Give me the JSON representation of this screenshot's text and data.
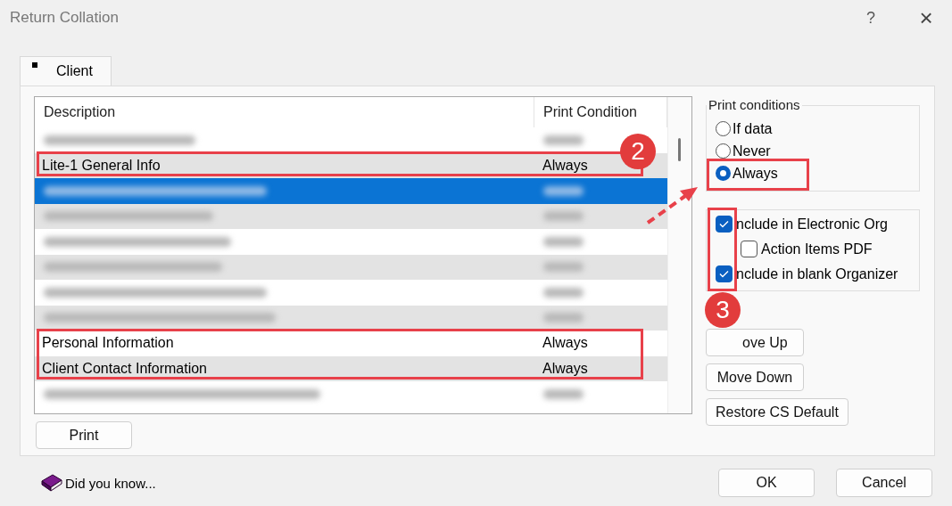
{
  "window": {
    "title": "Return Collation",
    "help": "?",
    "close": "×"
  },
  "tabs": [
    {
      "label": "Client",
      "selected": true
    }
  ],
  "list": {
    "columns": [
      "Description",
      "Print Condition"
    ],
    "rows": [
      {
        "kind": "blurred",
        "selected": false
      },
      {
        "kind": "text",
        "description": "Lite-1 General Info",
        "condition": "Always",
        "selected": false
      },
      {
        "kind": "blurred",
        "selected": true
      },
      {
        "kind": "blurred",
        "selected": false
      },
      {
        "kind": "blurred",
        "selected": false
      },
      {
        "kind": "blurred",
        "selected": false
      },
      {
        "kind": "blurred",
        "selected": false
      },
      {
        "kind": "blurred",
        "selected": false
      },
      {
        "kind": "text",
        "description": "Personal Information",
        "condition": "Always",
        "selected": false
      },
      {
        "kind": "text",
        "description": "Client Contact Information",
        "condition": "Always",
        "selected": false
      },
      {
        "kind": "blurred",
        "selected": false
      }
    ]
  },
  "print_button": "Print",
  "print_conditions": {
    "title": "Print conditions",
    "options": [
      {
        "label": "If data",
        "selected": false
      },
      {
        "label": "Never",
        "selected": false
      },
      {
        "label": "Always",
        "selected": true
      }
    ]
  },
  "options": [
    {
      "label": "nclude in Electronic Org",
      "checked": true,
      "indented": false
    },
    {
      "label": "Action Items PDF",
      "checked": false,
      "indented": true
    },
    {
      "label": "nclude in blank Organizer",
      "checked": true,
      "indented": false
    }
  ],
  "side_buttons": [
    "ove Up",
    "Move Down",
    "Restore CS Default"
  ],
  "did_you_know": "Did you know...",
  "footer_buttons": [
    "OK",
    "Cancel"
  ],
  "callouts": [
    {
      "label": "2"
    },
    {
      "label": "3"
    }
  ]
}
